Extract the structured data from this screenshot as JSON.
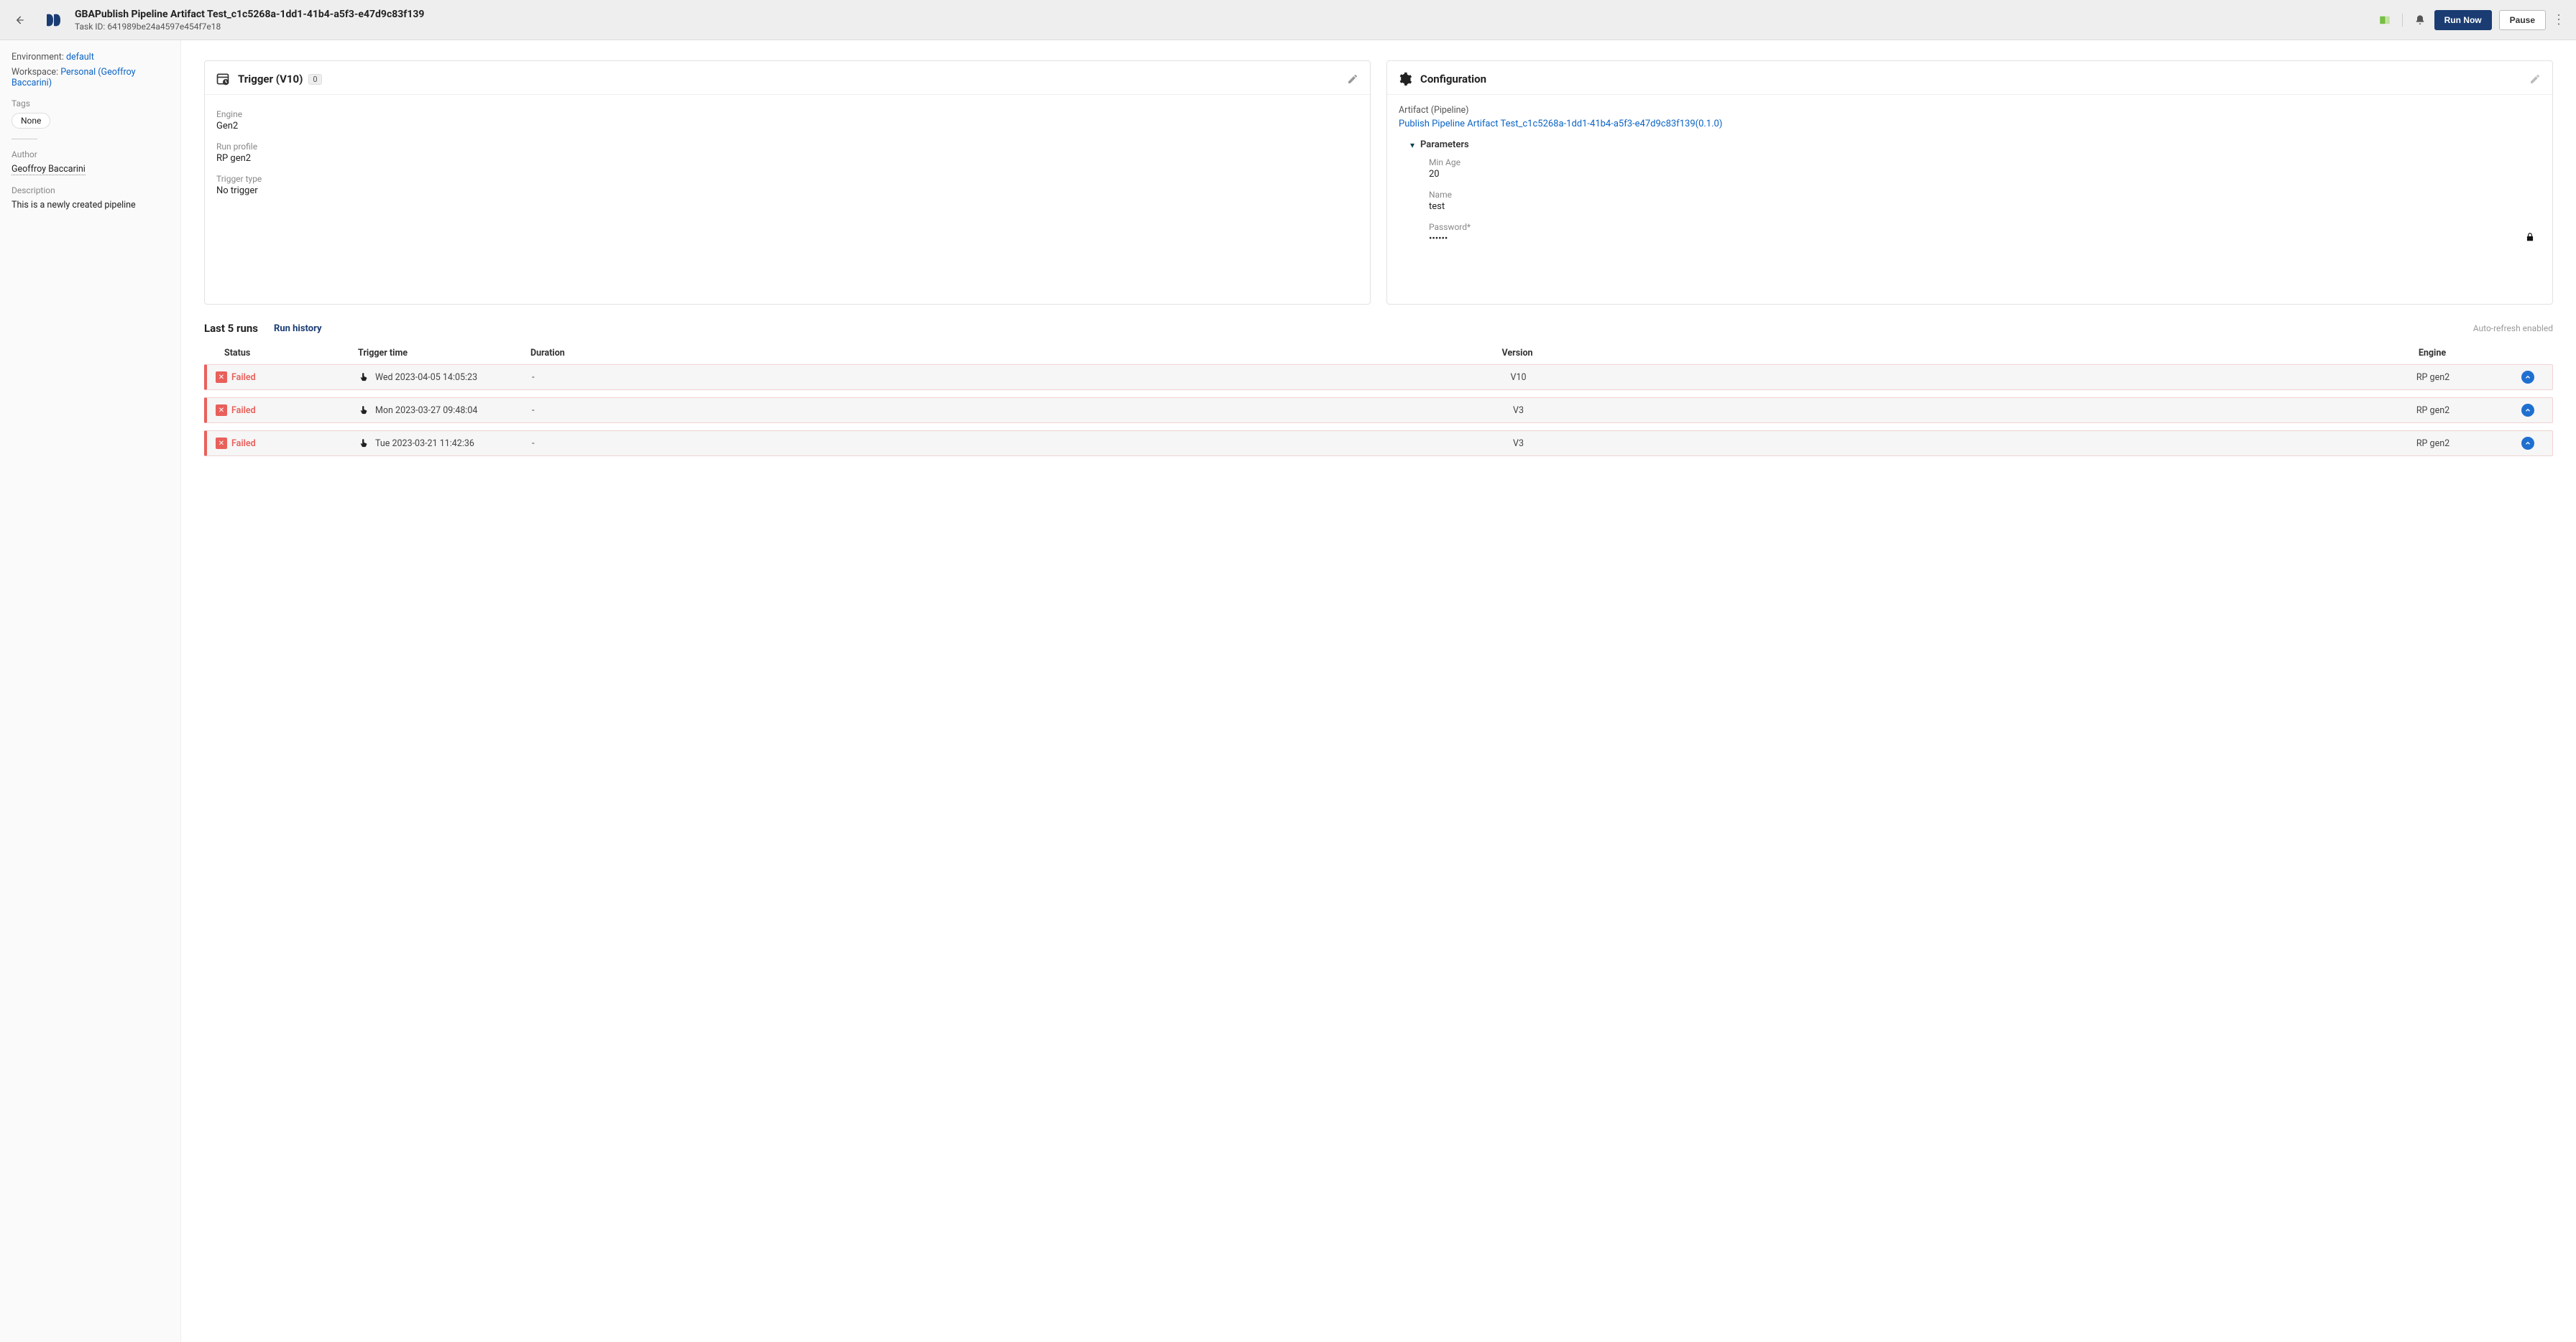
{
  "header": {
    "title": "GBAPublish Pipeline Artifact Test_c1c5268a-1dd1-41b4-a5f3-e47d9c83f139",
    "task_id_label": "Task ID:",
    "task_id": "641989be24a4597e454f7e18",
    "run_now": "Run Now",
    "pause": "Pause"
  },
  "sidebar": {
    "env_label": "Environment:",
    "env_value": "default",
    "ws_label": "Workspace:",
    "ws_value": "Personal (Geoffroy Baccarini)",
    "tags_label": "Tags",
    "tag_none": "None",
    "author_label": "Author",
    "author_value": "Geoffroy Baccarini",
    "desc_label": "Description",
    "desc_value": "This is a newly created pipeline"
  },
  "trigger": {
    "title": "Trigger (V10)",
    "count": "0",
    "engine_label": "Engine",
    "engine_value": "Gen2",
    "profile_label": "Run profile",
    "profile_value": "RP gen2",
    "type_label": "Trigger type",
    "type_value": "No trigger"
  },
  "config": {
    "title": "Configuration",
    "artifact_label": "Artifact (Pipeline)",
    "artifact_link": "Publish Pipeline Artifact Test_c1c5268a-1dd1-41b4-a5f3-e47d9c83f139(0.1.0)",
    "params_title": "Parameters",
    "minage_label": "Min Age",
    "minage_value": "20",
    "name_label": "Name",
    "name_value": "test",
    "password_label": "Password*",
    "password_value": "••••••"
  },
  "runs": {
    "title": "Last 5 runs",
    "history_link": "Run history",
    "refresh": "Auto-refresh enabled",
    "cols": {
      "status": "Status",
      "trigger": "Trigger time",
      "duration": "Duration",
      "version": "Version",
      "engine": "Engine"
    },
    "rows": [
      {
        "status": "Failed",
        "time": "Wed 2023-04-05 14:05:23",
        "duration": "-",
        "version": "V10",
        "engine": "RP gen2"
      },
      {
        "status": "Failed",
        "time": "Mon 2023-03-27 09:48:04",
        "duration": "-",
        "version": "V3",
        "engine": "RP gen2"
      },
      {
        "status": "Failed",
        "time": "Tue 2023-03-21 11:42:36",
        "duration": "-",
        "version": "V3",
        "engine": "RP gen2"
      }
    ]
  }
}
